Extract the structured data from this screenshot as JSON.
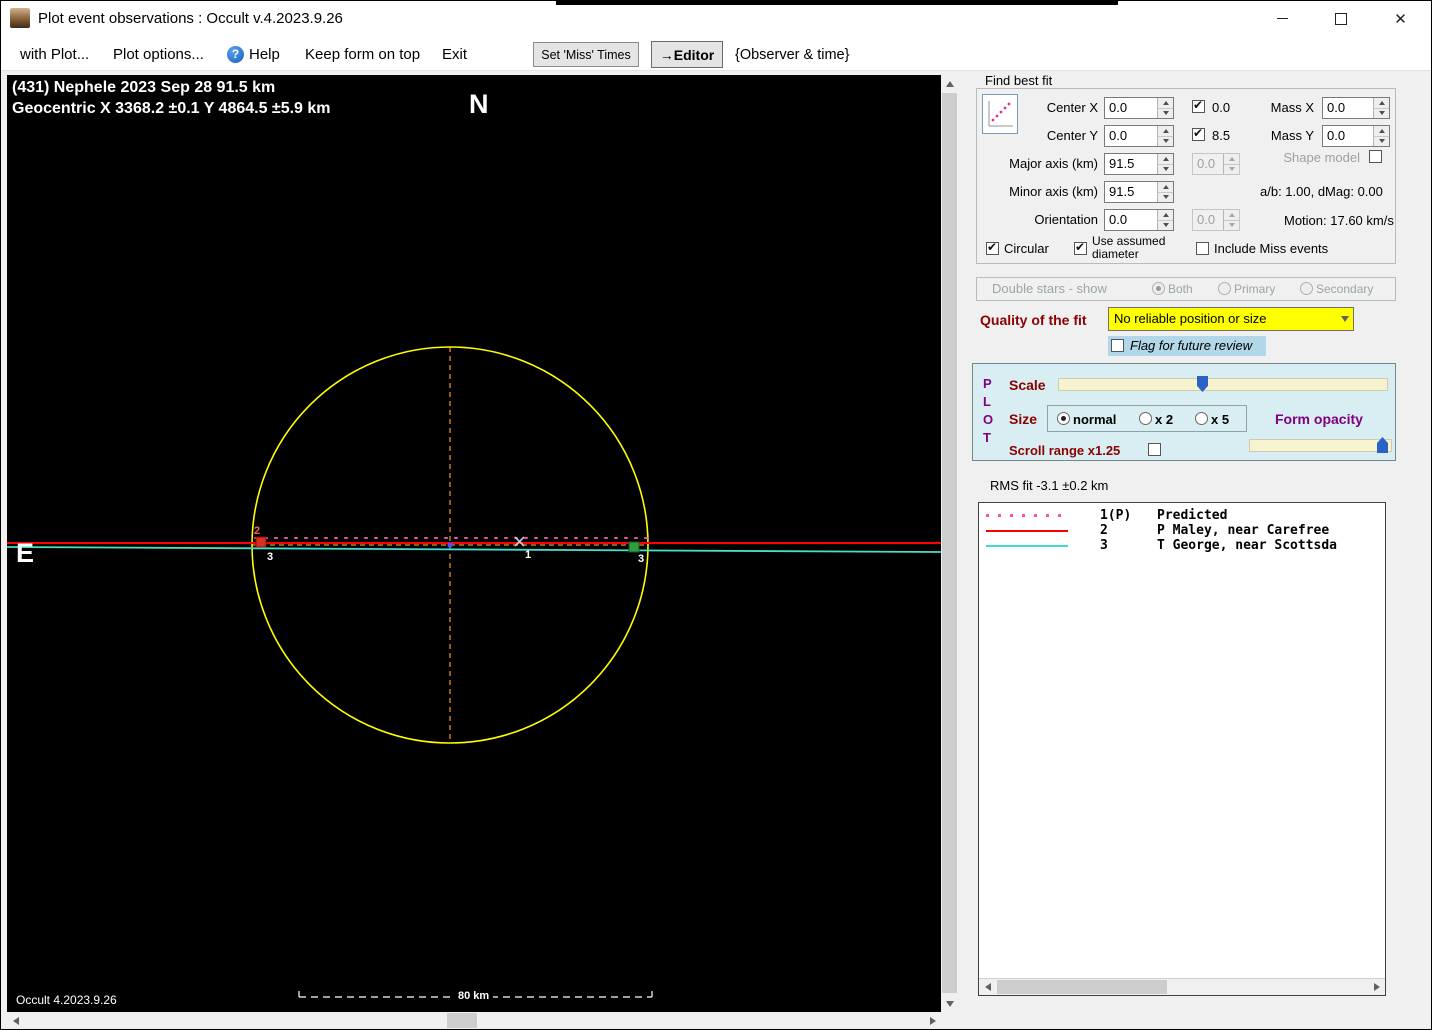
{
  "window": {
    "title": "Plot event observations : Occult v.4.2023.9.26"
  },
  "menu": {
    "with_plot": "with Plot...",
    "plot_options": "Plot options...",
    "help": "Help",
    "keep_on_top": "Keep form on top",
    "exit": "Exit",
    "set_miss_times": "Set 'Miss' Times",
    "editor": "→Editor",
    "observer_time": "{Observer & time}"
  },
  "plot": {
    "title_line1": "(431) Nephele  2023 Sep 28   91.5 km",
    "title_line2": "Geocentric  X  3368.2 ±0.1  Y 4864.5 ±5.9 km",
    "north": "N",
    "east": "E",
    "version": "Occult 4.2023.9.26",
    "scale_bar": "80 km",
    "labels": {
      "chord1_mid": "1",
      "chord2_left": "2",
      "chord3_left": "3",
      "chord3_right": "3"
    }
  },
  "fbf": {
    "title": "Find best fit",
    "center_x": "Center X",
    "center_x_val": "0.0",
    "center_x_fit": "0.0",
    "center_y": "Center Y",
    "center_y_val": "0.0",
    "center_y_fit": "8.5",
    "mass_x": "Mass X",
    "mass_x_val": "0.0",
    "mass_y": "Mass Y",
    "mass_y_val": "0.0",
    "major": "Major axis (km)",
    "major_val": "91.5",
    "major_fit": "0.0",
    "minor": "Minor axis (km)",
    "minor_val": "91.5",
    "orient": "Orientation",
    "orient_val": "0.0",
    "orient_fit": "0.0",
    "shape_model": "Shape model",
    "ab_dmag": "a/b: 1.00, dMag: 0.00",
    "motion": "Motion: 17.60 km/s",
    "circular": "Circular",
    "use_assumed_1": "Use assumed",
    "use_assumed_2": "diameter",
    "include_miss": "Include Miss events"
  },
  "double_stars": {
    "title": "Double stars - show",
    "both": "Both",
    "primary": "Primary",
    "secondary": "Secondary"
  },
  "quality": {
    "label": "Quality of the fit",
    "value": "No reliable position or size",
    "flag": "Flag for future review"
  },
  "plot_panel": {
    "p": "P",
    "l": "L",
    "o": "O",
    "t": "T",
    "scale": "Scale",
    "size": "Size",
    "size_normal": "normal",
    "size_x2": "x 2",
    "size_x5": "x 5",
    "form_opacity": "Form opacity",
    "scroll_range": "Scroll range x1.25"
  },
  "rms": "RMS fit -3.1 ±0.2 km",
  "legend": {
    "rows": [
      {
        "num": "1(P)",
        "name": "Predicted"
      },
      {
        "num": "2",
        "name": "P Maley, near Carefree"
      },
      {
        "num": "3",
        "name": "T George, near Scottsda"
      }
    ]
  },
  "colors": {
    "asteroid_circle": "#ffff00",
    "crosshair": "#c87820",
    "predicted": "#ff50a8",
    "chord2": "#ff0000",
    "chord3": "#44e0c8",
    "quality_bg": "#ffff00",
    "flag_bg": "#b2d7e8",
    "plot_panel_bg": "#d8eef2"
  }
}
